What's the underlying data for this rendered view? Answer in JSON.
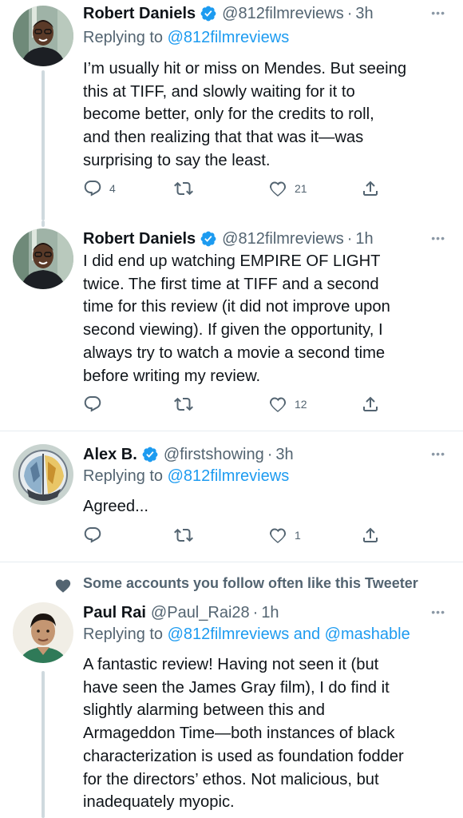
{
  "tweets": [
    {
      "name": "Robert Daniels",
      "handle": "@812filmreviews",
      "time": "3h",
      "more": "•••",
      "replying_prefix": "Replying to ",
      "replying_to": "@812filmreviews",
      "lines": [
        "I’m usually hit or miss on Mendes. But seeing",
        "this at TIFF, and slowly waiting for it to",
        "become better, only for the credits to roll,",
        "and then realizing that that was it—was",
        "surprising to say the least."
      ],
      "reply_count": "4",
      "retweet_count": "",
      "like_count": "21"
    },
    {
      "name": "Robert Daniels",
      "handle": "@812filmreviews",
      "time": "1h",
      "more": "•••",
      "lines": [
        "I did end up watching EMPIRE OF LIGHT",
        "twice. The first time at TIFF and a second",
        "time for this review (it did not improve upon",
        "second viewing). If given the opportunity, I",
        "always try to watch a movie a second time",
        "before writing my review."
      ],
      "reply_count": "",
      "retweet_count": "",
      "like_count": "12"
    },
    {
      "name": "Alex B.",
      "handle": "@firstshowing",
      "time": "3h",
      "more": "•••",
      "replying_prefix": "Replying to ",
      "replying_to": "@812filmreviews",
      "lines": [
        "Agreed..."
      ],
      "reply_count": "",
      "retweet_count": "",
      "like_count": "1"
    },
    {
      "social_context": "Some accounts you follow often like this Tweeter",
      "name": "Paul Rai",
      "handle": "@Paul_Rai28",
      "time": "1h",
      "more": "•••",
      "replying_prefix": "Replying to ",
      "replying_to": "@812filmreviews and @mashable",
      "lines": [
        "A fantastic review! Having not seen it (but",
        "have seen the James Gray film), I do find it",
        "slightly alarming between this and",
        "Armageddon Time—both instances of black",
        "characterization is used as foundation fodder",
        "for the directors’ ethos. Not malicious, but",
        "inadequately myopic."
      ]
    }
  ],
  "colors": {
    "accent": "#1d9bf0",
    "secondary_text": "#536471",
    "primary_text": "#0f1419",
    "thread_line": "#cfd9de"
  },
  "icons": [
    "verified-badge-icon",
    "reply-icon",
    "retweet-icon",
    "like-icon",
    "share-icon",
    "more-icon",
    "heart-icon"
  ]
}
